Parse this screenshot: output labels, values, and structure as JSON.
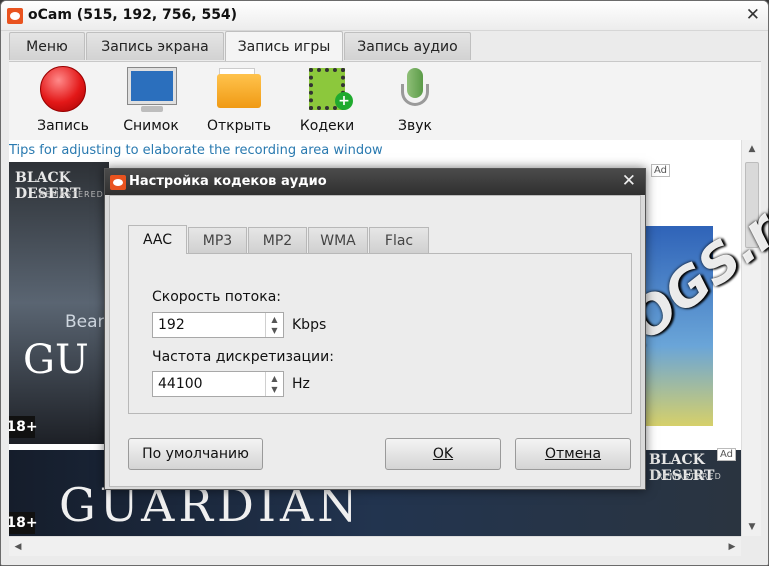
{
  "window": {
    "title": "oCam (515, 192, 756, 554)",
    "close_glyph": "✕"
  },
  "tabs": [
    {
      "label": "Меню"
    },
    {
      "label": "Запись экрана"
    },
    {
      "label": "Запись игры",
      "active": true
    },
    {
      "label": "Запись аудио"
    }
  ],
  "toolbar": {
    "record": {
      "label": "Запись",
      "icon": "record-icon"
    },
    "screenshot": {
      "label": "Снимок",
      "icon": "monitor-icon"
    },
    "open": {
      "label": "Открыть",
      "icon": "folder-icon"
    },
    "codecs": {
      "label": "Кодеки",
      "icon": "film-plus-icon"
    },
    "sound": {
      "label": "Звук",
      "icon": "microphone-icon"
    }
  },
  "content": {
    "tips": "Tips for adjusting to elaborate the recording area window",
    "ad1": {
      "logo": "BLACK DESERT",
      "sub": "REMASTERED",
      "line": "Bear",
      "big": "GU",
      "age": "18+"
    },
    "ad2": {
      "big": "GUARDIAN",
      "logo": "BLACK DESERT",
      "sub": "REMASTERED",
      "age": "18+"
    },
    "ad_tag": "Ad"
  },
  "watermark": "OKPROGS.ru",
  "dialog": {
    "title": "Настройка кодеков аудио",
    "close_glyph": "✕",
    "tabs": [
      {
        "label": "AAC",
        "active": true
      },
      {
        "label": "MP3"
      },
      {
        "label": "MP2"
      },
      {
        "label": "WMA"
      },
      {
        "label": "Flac"
      }
    ],
    "bitrate": {
      "label": "Скорость потока:",
      "value": "192",
      "unit": "Kbps"
    },
    "samplerate": {
      "label": "Частота дискретизации:",
      "value": "44100",
      "unit": "Hz"
    },
    "buttons": {
      "default": "По умолчанию",
      "ok": "OK",
      "cancel": "Отмена"
    }
  },
  "colors": {
    "accent_link": "#2a7ab0",
    "record_red": "#e31818",
    "dialog_title": "#3a3a3a"
  }
}
